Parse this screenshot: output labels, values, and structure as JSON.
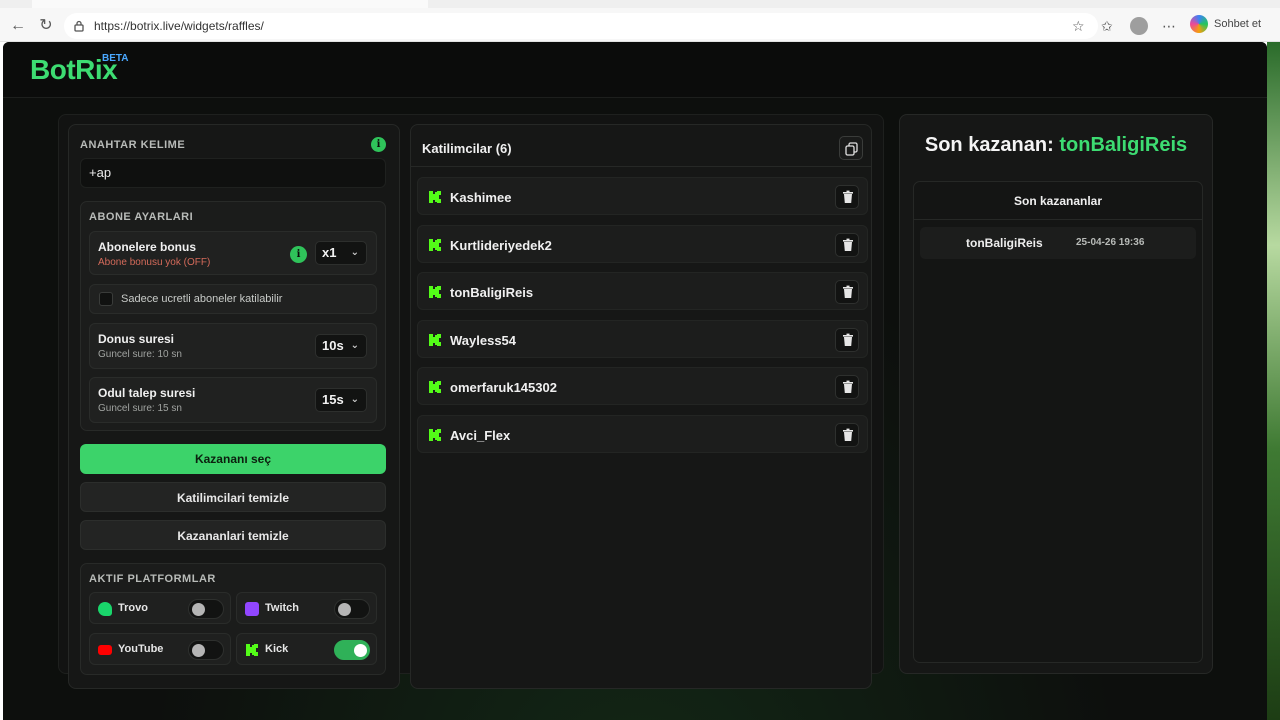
{
  "browser": {
    "url": "https://botrix.live/widgets/raffles/",
    "copilot_label": "Sohbet et"
  },
  "header": {
    "brand": "BotRix",
    "beta": "BETA"
  },
  "settings": {
    "keyword_label": "ANAHTAR KELIME",
    "keyword_value": "+ap",
    "subscriber_section": "ABONE AYARLARI",
    "sub_bonus_title": "Abonelere bonus",
    "sub_bonus_sub": "Abone bonusu yok (OFF)",
    "sub_bonus_value": "x1",
    "paid_only_label": "Sadece ucretli aboneler katilabilir",
    "spin_title": "Donus suresi",
    "spin_sub": "Guncel sure: 10 sn",
    "spin_value": "10s",
    "claim_title": "Odul talep suresi",
    "claim_sub": "Guncel sure: 15 sn",
    "claim_value": "15s",
    "pick_winner": "Kazananı seç",
    "clear_participants": "Katilimcilari temizle",
    "clear_winners": "Kazananlari temizle",
    "platforms_title": "AKTIF PLATFORMLAR",
    "platforms": [
      {
        "name": "Trovo",
        "enabled": false,
        "color": "#19d66b"
      },
      {
        "name": "Twitch",
        "enabled": false,
        "color": "#9146ff"
      },
      {
        "name": "YouTube",
        "enabled": false,
        "color": "#ff0000"
      },
      {
        "name": "Kick",
        "enabled": true,
        "color": "#53fc18"
      }
    ]
  },
  "participants": {
    "header": "Katilimcilar (6)",
    "list": [
      "Kashimee",
      "Kurtlideriyedek2",
      "tonBaligiReis",
      "Wayless54",
      "omerfaruk145302",
      "Avci_Flex"
    ]
  },
  "winners": {
    "last_winner_prefix": "Son kazanan: ",
    "last_winner_name": "tonBaligiReis",
    "list_title": "Son kazananlar",
    "entries": [
      {
        "name": "tonBaligiReis",
        "date": "25-04-26 19:36"
      }
    ]
  },
  "colors": {
    "accent": "#3ddc72",
    "beta": "#4aa8ff"
  }
}
